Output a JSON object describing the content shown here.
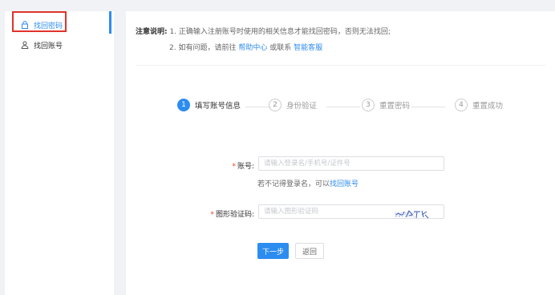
{
  "sidebar": {
    "items": [
      {
        "label": "找回密码",
        "icon": "lock-icon",
        "active": true
      },
      {
        "label": "找回账号",
        "icon": "user-icon",
        "active": false
      }
    ]
  },
  "notice": {
    "title": "注意说明:",
    "line1": "1. 正确输入注册账号时使用的相关信息才能找回密码，否则无法找回;",
    "line2_prefix": "2. 如有问题，请前往",
    "line2_link1": "帮助中心",
    "line2_middle": "或联系",
    "line2_link2": "智能客服"
  },
  "steps": [
    {
      "num": "1",
      "label": "填写账号信息",
      "active": true
    },
    {
      "num": "2",
      "label": "身份验证",
      "active": false
    },
    {
      "num": "3",
      "label": "重置密码",
      "active": false
    },
    {
      "num": "4",
      "label": "重置成功",
      "active": false
    }
  ],
  "form": {
    "account_label": "账号:",
    "account_placeholder": "请输入登录名/手机号/证件号",
    "hint_prefix": "若不记得登录名，可以",
    "hint_link": "找回账号",
    "captcha_label": "图形验证码:",
    "captcha_placeholder": "请输入图形验证码",
    "captcha_text": "WPTK",
    "required_mark": "*"
  },
  "buttons": {
    "next": "下一步",
    "back": "返回"
  },
  "colors": {
    "accent": "#2d8cf0",
    "highlight_border": "#e0332b",
    "required": "#ed4014"
  }
}
